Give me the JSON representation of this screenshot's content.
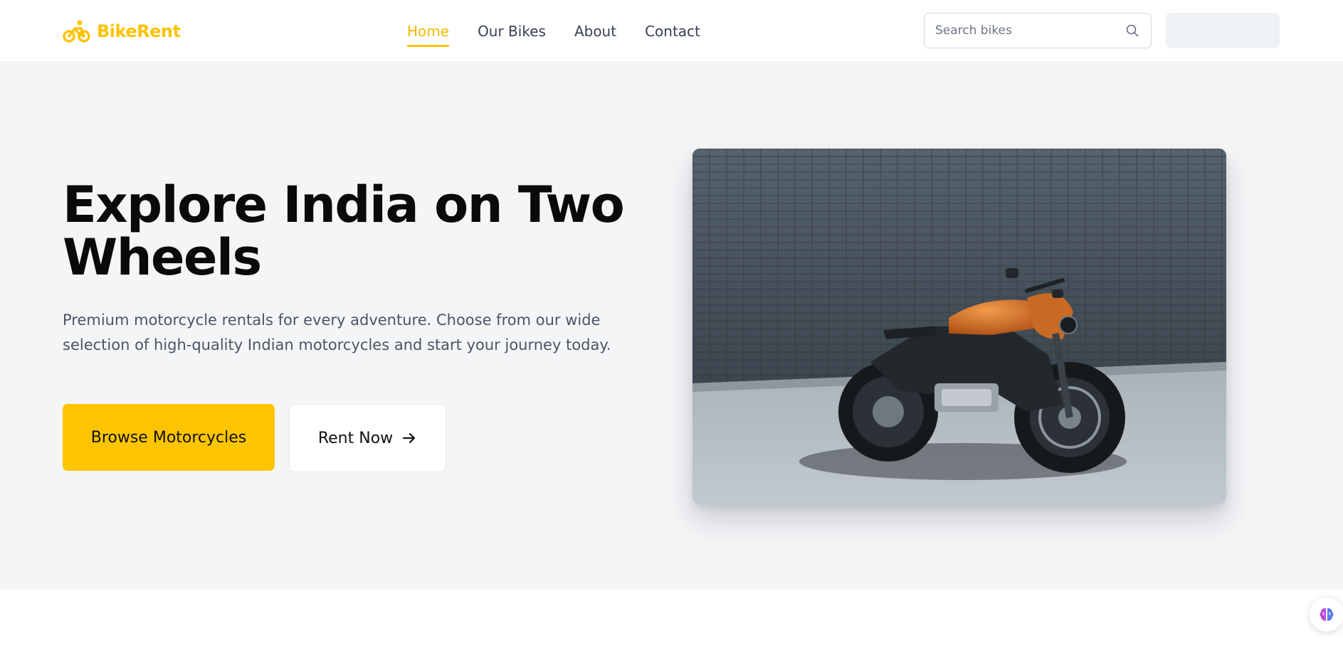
{
  "brand": {
    "name": "BikeRent",
    "icon": "bike-icon",
    "color": "#fbc300"
  },
  "nav": {
    "items": [
      {
        "label": "Home",
        "active": true
      },
      {
        "label": "Our Bikes",
        "active": false
      },
      {
        "label": "About",
        "active": false
      },
      {
        "label": "Contact",
        "active": false
      }
    ]
  },
  "search": {
    "placeholder": "Search bikes",
    "value": "",
    "icon": "search-icon"
  },
  "hero": {
    "title": "Explore India on Two Wheels",
    "subtitle": "Premium motorcycle rentals for every adventure. Choose from our wide selection of high-quality Indian motorcycles and start your journey today.",
    "primary_cta": "Browse Motorcycles",
    "secondary_cta": "Rent Now",
    "secondary_icon": "arrow-right-icon",
    "image_subject": "orange and black motorcycle parked in front of a grey tiled wall"
  },
  "colors": {
    "accent": "#fcc500",
    "hero_bg": "#f4f5f7",
    "text_dark": "#0a0a0a",
    "text_muted": "#4b5563"
  },
  "floating": {
    "icon": "brain-icon"
  }
}
